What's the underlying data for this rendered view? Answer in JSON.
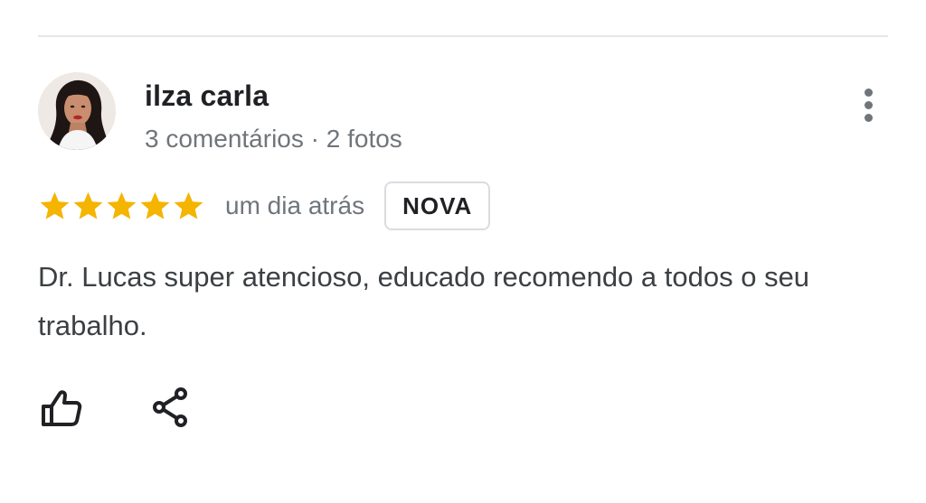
{
  "review": {
    "author_name": "ilza carla",
    "author_meta": "3 comentários · 2 fotos",
    "rating": 5,
    "rating_max": 5,
    "star_color": "#f4b400",
    "date": "um dia atrás",
    "badge": "NOVA",
    "text": "Dr. Lucas super atencioso, educado recomendo a todos o seu trabalho."
  },
  "icons": {
    "avatar": "user-avatar-photo",
    "more": "more-vertical-icon",
    "like": "thumbs-up-icon",
    "share": "share-icon"
  }
}
